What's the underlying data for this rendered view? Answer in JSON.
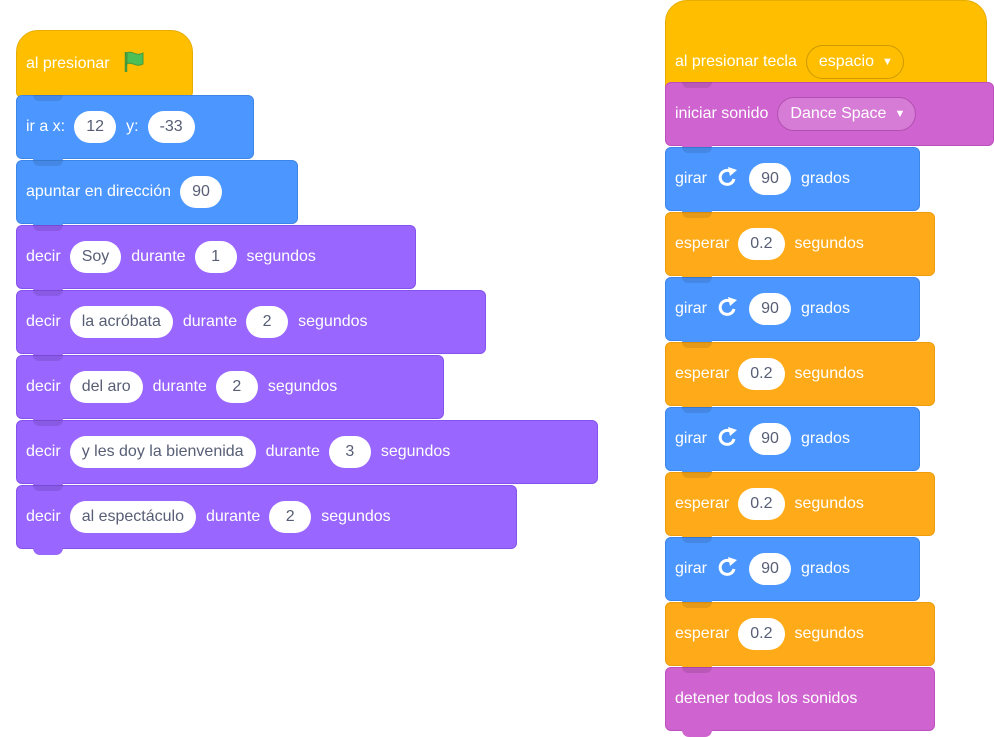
{
  "stack_left": {
    "hat": {
      "label": "al presionar",
      "icon": "green-flag-icon"
    },
    "goto": {
      "label": "ir a x:",
      "x": "12",
      "y_label": "y:",
      "y": "-33"
    },
    "point": {
      "label": "apuntar en dirección",
      "value": "90"
    },
    "says": [
      {
        "label": "decir",
        "text": "Soy",
        "mid": "durante",
        "secs": "1",
        "unit": "segundos"
      },
      {
        "label": "decir",
        "text": "la acróbata",
        "mid": "durante",
        "secs": "2",
        "unit": "segundos"
      },
      {
        "label": "decir",
        "text": "del aro",
        "mid": "durante",
        "secs": "2",
        "unit": "segundos"
      },
      {
        "label": "decir",
        "text": "y les doy la bienvenida",
        "mid": "durante",
        "secs": "3",
        "unit": "segundos"
      },
      {
        "label": "decir",
        "text": "al espectáculo",
        "mid": "durante",
        "secs": "2",
        "unit": "segundos"
      }
    ]
  },
  "stack_right": {
    "hat": {
      "label": "al presionar tecla",
      "key": "espacio"
    },
    "sound": {
      "label": "iniciar sonido",
      "value": "Dance Space"
    },
    "steps": [
      {
        "turn": {
          "label": "girar",
          "value": "90",
          "unit": "grados"
        },
        "wait": {
          "label": "esperar",
          "value": "0.2",
          "unit": "segundos"
        }
      },
      {
        "turn": {
          "label": "girar",
          "value": "90",
          "unit": "grados"
        },
        "wait": {
          "label": "esperar",
          "value": "0.2",
          "unit": "segundos"
        }
      },
      {
        "turn": {
          "label": "girar",
          "value": "90",
          "unit": "grados"
        },
        "wait": {
          "label": "esperar",
          "value": "0.2",
          "unit": "segundos"
        }
      },
      {
        "turn": {
          "label": "girar",
          "value": "90",
          "unit": "grados"
        },
        "wait": {
          "label": "esperar",
          "value": "0.2",
          "unit": "segundos"
        }
      }
    ],
    "stop": {
      "label": "detener todos los sonidos"
    }
  },
  "colors": {
    "motion": "#4C97FF",
    "looks": "#9966FF",
    "events": "#FFBF00",
    "control": "#FFAB19",
    "sound": "#CF63CF",
    "flag": "#4CBF56"
  }
}
